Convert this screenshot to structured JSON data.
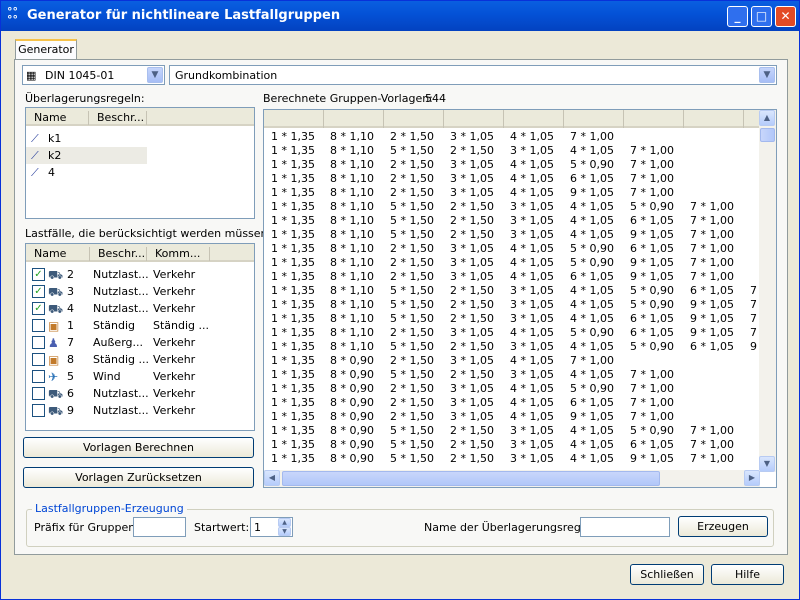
{
  "window": {
    "title": "Generator für nichtlineare Lastfallgruppen",
    "minimize": "_",
    "maximize": "□",
    "close": "✕"
  },
  "tab": "Generator",
  "norm_combo": {
    "value": "DIN 1045-01"
  },
  "combination_combo": {
    "value": "Grundkombination"
  },
  "rules": {
    "label": "Überlagerungsregeln:",
    "columns": [
      "Name",
      "Beschr..."
    ],
    "items": [
      {
        "name": "k1",
        "selected": false
      },
      {
        "name": "k2",
        "selected": true
      },
      {
        "name": "4",
        "selected": false
      }
    ]
  },
  "loadcases": {
    "label": "Lastfälle, die berücksichtigt werden müssen:",
    "columns": [
      "Name",
      "Beschr...",
      "Komm..."
    ],
    "items": [
      {
        "checked": true,
        "icon": "vehicle-icon",
        "name": "2",
        "desc": "Nutzlast...",
        "comment": "Verkehr"
      },
      {
        "checked": true,
        "icon": "vehicle-icon",
        "name": "3",
        "desc": "Nutzlast...",
        "comment": "Verkehr"
      },
      {
        "checked": true,
        "icon": "vehicle-icon",
        "name": "4",
        "desc": "Nutzlast...",
        "comment": "Verkehr"
      },
      {
        "checked": false,
        "icon": "box-icon",
        "name": "1",
        "desc": "Ständig",
        "comment": "Ständig ..."
      },
      {
        "checked": false,
        "icon": "person-icon",
        "name": "7",
        "desc": "Außerg...",
        "comment": "Verkehr"
      },
      {
        "checked": false,
        "icon": "box-icon",
        "name": "8",
        "desc": "Ständig ...",
        "comment": "Verkehr"
      },
      {
        "checked": false,
        "icon": "wind-icon",
        "name": "5",
        "desc": "Wind",
        "comment": "Verkehr"
      },
      {
        "checked": false,
        "icon": "vehicle-icon",
        "name": "6",
        "desc": "Nutzlast...",
        "comment": "Verkehr"
      },
      {
        "checked": false,
        "icon": "vehicle-icon",
        "name": "9",
        "desc": "Nutzlast...",
        "comment": "Verkehr"
      }
    ]
  },
  "buttons": {
    "calculate": "Vorlagen Berechnen",
    "reset": "Vorlagen Zurücksetzen",
    "generate": "Erzeugen",
    "close": "Schließen",
    "help": "Hilfe"
  },
  "templates": {
    "label": "Berechnete Gruppen-Vorlagen:",
    "count": "544",
    "rows": [
      [
        "1 * 1,35",
        "8 * 1,10",
        "2 * 1,50",
        "3 * 1,05",
        "4 * 1,05",
        "7 * 1,00",
        "",
        ""
      ],
      [
        "1 * 1,35",
        "8 * 1,10",
        "5 * 1,50",
        "2 * 1,50",
        "3 * 1,05",
        "4 * 1,05",
        "7 * 1,00",
        ""
      ],
      [
        "1 * 1,35",
        "8 * 1,10",
        "2 * 1,50",
        "3 * 1,05",
        "4 * 1,05",
        "5 * 0,90",
        "7 * 1,00",
        ""
      ],
      [
        "1 * 1,35",
        "8 * 1,10",
        "2 * 1,50",
        "3 * 1,05",
        "4 * 1,05",
        "6 * 1,05",
        "7 * 1,00",
        ""
      ],
      [
        "1 * 1,35",
        "8 * 1,10",
        "2 * 1,50",
        "3 * 1,05",
        "4 * 1,05",
        "9 * 1,05",
        "7 * 1,00",
        ""
      ],
      [
        "1 * 1,35",
        "8 * 1,10",
        "5 * 1,50",
        "2 * 1,50",
        "3 * 1,05",
        "4 * 1,05",
        "5 * 0,90",
        "7 * 1,00"
      ],
      [
        "1 * 1,35",
        "8 * 1,10",
        "5 * 1,50",
        "2 * 1,50",
        "3 * 1,05",
        "4 * 1,05",
        "6 * 1,05",
        "7 * 1,00"
      ],
      [
        "1 * 1,35",
        "8 * 1,10",
        "5 * 1,50",
        "2 * 1,50",
        "3 * 1,05",
        "4 * 1,05",
        "9 * 1,05",
        "7 * 1,00"
      ],
      [
        "1 * 1,35",
        "8 * 1,10",
        "2 * 1,50",
        "3 * 1,05",
        "4 * 1,05",
        "5 * 0,90",
        "6 * 1,05",
        "7 * 1,00"
      ],
      [
        "1 * 1,35",
        "8 * 1,10",
        "2 * 1,50",
        "3 * 1,05",
        "4 * 1,05",
        "5 * 0,90",
        "9 * 1,05",
        "7 * 1,00"
      ],
      [
        "1 * 1,35",
        "8 * 1,10",
        "2 * 1,50",
        "3 * 1,05",
        "4 * 1,05",
        "6 * 1,05",
        "9 * 1,05",
        "7 * 1,00"
      ],
      [
        "1 * 1,35",
        "8 * 1,10",
        "5 * 1,50",
        "2 * 1,50",
        "3 * 1,05",
        "4 * 1,05",
        "5 * 0,90",
        "6 * 1,05",
        "7"
      ],
      [
        "1 * 1,35",
        "8 * 1,10",
        "5 * 1,50",
        "2 * 1,50",
        "3 * 1,05",
        "4 * 1,05",
        "5 * 0,90",
        "9 * 1,05",
        "7"
      ],
      [
        "1 * 1,35",
        "8 * 1,10",
        "5 * 1,50",
        "2 * 1,50",
        "3 * 1,05",
        "4 * 1,05",
        "6 * 1,05",
        "9 * 1,05",
        "7"
      ],
      [
        "1 * 1,35",
        "8 * 1,10",
        "2 * 1,50",
        "3 * 1,05",
        "4 * 1,05",
        "5 * 0,90",
        "6 * 1,05",
        "9 * 1,05",
        "7"
      ],
      [
        "1 * 1,35",
        "8 * 1,10",
        "5 * 1,50",
        "2 * 1,50",
        "3 * 1,05",
        "4 * 1,05",
        "5 * 0,90",
        "6 * 1,05",
        "9"
      ],
      [
        "1 * 1,35",
        "8 * 0,90",
        "2 * 1,50",
        "3 * 1,05",
        "4 * 1,05",
        "7 * 1,00",
        "",
        ""
      ],
      [
        "1 * 1,35",
        "8 * 0,90",
        "5 * 1,50",
        "2 * 1,50",
        "3 * 1,05",
        "4 * 1,05",
        "7 * 1,00",
        ""
      ],
      [
        "1 * 1,35",
        "8 * 0,90",
        "2 * 1,50",
        "3 * 1,05",
        "4 * 1,05",
        "5 * 0,90",
        "7 * 1,00",
        ""
      ],
      [
        "1 * 1,35",
        "8 * 0,90",
        "2 * 1,50",
        "3 * 1,05",
        "4 * 1,05",
        "6 * 1,05",
        "7 * 1,00",
        ""
      ],
      [
        "1 * 1,35",
        "8 * 0,90",
        "2 * 1,50",
        "3 * 1,05",
        "4 * 1,05",
        "9 * 1,05",
        "7 * 1,00",
        ""
      ],
      [
        "1 * 1,35",
        "8 * 0,90",
        "5 * 1,50",
        "2 * 1,50",
        "3 * 1,05",
        "4 * 1,05",
        "5 * 0,90",
        "7 * 1,00"
      ],
      [
        "1 * 1,35",
        "8 * 0,90",
        "5 * 1,50",
        "2 * 1,50",
        "3 * 1,05",
        "4 * 1,05",
        "6 * 1,05",
        "7 * 1,00"
      ],
      [
        "1 * 1,35",
        "8 * 0,90",
        "5 * 1,50",
        "2 * 1,50",
        "3 * 1,05",
        "4 * 1,05",
        "9 * 1,05",
        "7 * 1,00"
      ]
    ]
  },
  "generation": {
    "legend": "Lastfallgruppen-Erzeugung",
    "prefix_label": "Präfix für Gruppen:",
    "prefix_value": "",
    "start_label": "Startwert:",
    "start_value": "1",
    "rule_label": "Name der Überlagerungsregel:",
    "rule_value": ""
  },
  "colors": {
    "titlebar": "#0451d6",
    "dialog": "#ece9d8",
    "legend": "#0046d5"
  }
}
